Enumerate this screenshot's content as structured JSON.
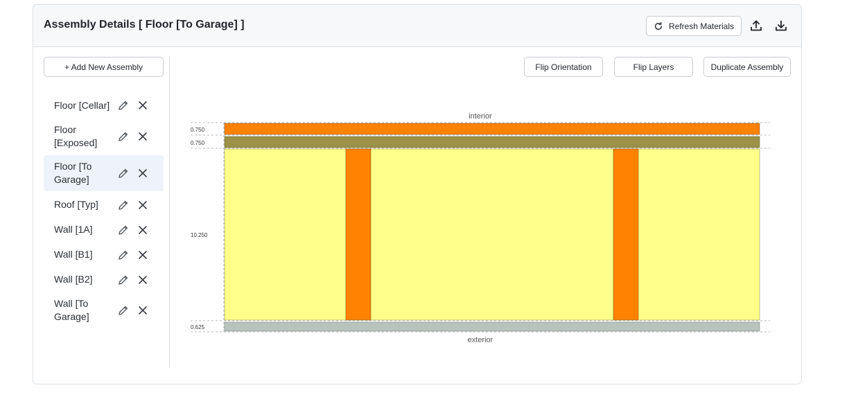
{
  "header": {
    "title": "Assembly Details [ Floor [To Garage] ]",
    "refresh_label": "Refresh Materials"
  },
  "sidebar": {
    "add_label": "+ Add New Assembly",
    "items": [
      {
        "label": "Floor [Cellar]",
        "selected": false
      },
      {
        "label": "Floor [Exposed]",
        "selected": false
      },
      {
        "label": "Floor [To Garage]",
        "selected": true
      },
      {
        "label": "Roof [Typ]",
        "selected": false
      },
      {
        "label": "Wall [1A]",
        "selected": false
      },
      {
        "label": "Wall [B1]",
        "selected": false
      },
      {
        "label": "Wall [B2]",
        "selected": false
      },
      {
        "label": "Wall [To Garage]",
        "selected": false
      }
    ]
  },
  "toolbar": {
    "flip_orientation": "Flip Orientation",
    "flip_layers": "Flip Layers",
    "duplicate": "Duplicate Assembly"
  },
  "diagram": {
    "top_label": "interior",
    "bottom_label": "exterior",
    "layers": [
      {
        "thickness": "0.750",
        "color": "#ff8200"
      },
      {
        "thickness": "0.750",
        "color": "#9b9147"
      },
      {
        "thickness": "10.250",
        "color": "#ffff8a",
        "stud_color": "#ff8200"
      },
      {
        "thickness": "0.625",
        "color": "#b9c3bd"
      }
    ]
  },
  "colors": {
    "selected_bg": "#eef3fb",
    "border": "#dcdfe3"
  }
}
